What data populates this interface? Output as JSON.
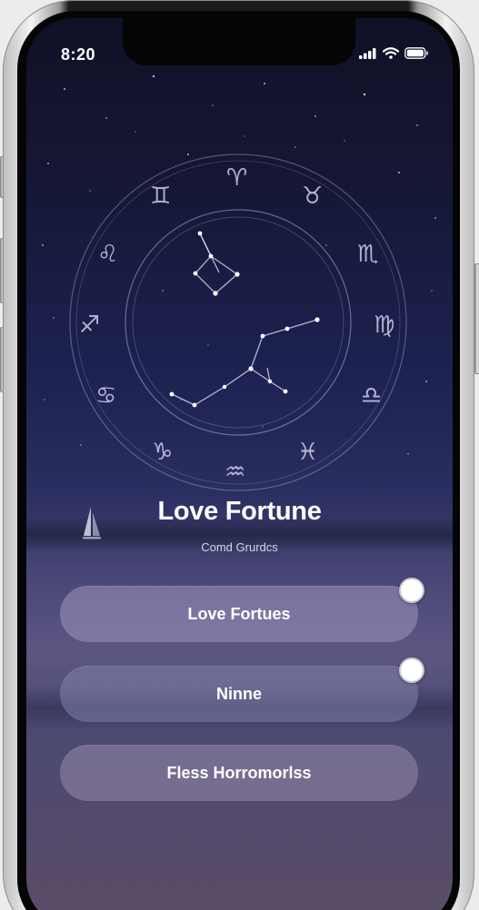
{
  "status_bar": {
    "time": "8:20"
  },
  "zodiac_glyphs": [
    "♊",
    "♈",
    "♉",
    "♌",
    "♏",
    "♐",
    "♍",
    "♋",
    "♎",
    "♑",
    "♒",
    "♓"
  ],
  "title": "Love Fortune",
  "subtitle": "Comd Grurdcs",
  "options": [
    {
      "label": "Love Fortues",
      "has_toggle": true
    },
    {
      "label": "Ninne",
      "has_toggle": true
    },
    {
      "label": "Fless Horromorlss",
      "has_toggle": false
    }
  ],
  "colors": {
    "accent": "#ffffff",
    "background_top": "#101126",
    "background_bottom": "#5a4c66",
    "button_fill": "#968cb2"
  }
}
